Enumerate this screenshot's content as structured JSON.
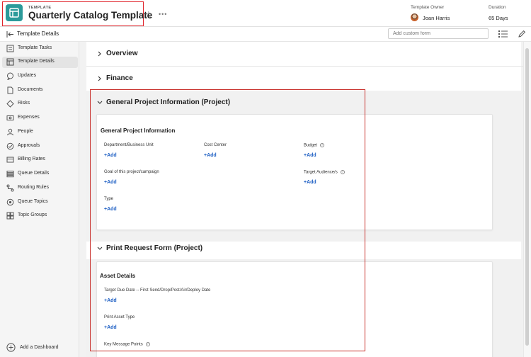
{
  "header": {
    "eyebrow": "TEMPLATE",
    "title": "Quarterly Catalog Template",
    "owner_label": "Template Owner",
    "owner_name": "Joan Harris",
    "duration_label": "Duration",
    "duration_value": "65 Days"
  },
  "subheader": {
    "title": "Template Details",
    "custom_form_placeholder": "Add custom form"
  },
  "sidebar": {
    "items": [
      {
        "label": "Template Tasks",
        "icon": "tasks-icon"
      },
      {
        "label": "Template Details",
        "icon": "details-icon",
        "active": true
      },
      {
        "label": "Updates",
        "icon": "chat-icon"
      },
      {
        "label": "Documents",
        "icon": "document-icon"
      },
      {
        "label": "Risks",
        "icon": "risk-icon"
      },
      {
        "label": "Expenses",
        "icon": "expenses-icon"
      },
      {
        "label": "People",
        "icon": "people-icon"
      },
      {
        "label": "Approvals",
        "icon": "approval-icon"
      },
      {
        "label": "Billing Rates",
        "icon": "billing-icon"
      },
      {
        "label": "Queue Details",
        "icon": "queue-icon"
      },
      {
        "label": "Routing Rules",
        "icon": "routing-icon"
      },
      {
        "label": "Queue Topics",
        "icon": "topics-icon"
      },
      {
        "label": "Topic Groups",
        "icon": "groups-icon"
      }
    ],
    "add_dashboard": "Add a Dashboard"
  },
  "sections": {
    "overview": "Overview",
    "finance": "Finance",
    "general": "General Project Information (Project)",
    "print": "Print Request Form (Project)"
  },
  "general_card": {
    "title": "General Project Information",
    "fields": {
      "department": "Department/Business Unit",
      "cost_center": "Cost Center",
      "budget": "Budget",
      "goal": "Goal of this project/campaign",
      "audience": "Target Audience/s",
      "type": "Type"
    }
  },
  "print_card": {
    "title": "Asset Details",
    "fields": {
      "due_date": "Target Due Date -- First Send/Drop/Post/Air/Deploy Date",
      "asset_type": "Print Asset Type",
      "key_points": "Key Message Points"
    }
  },
  "add_label": "+Add",
  "colors": {
    "brand_tile": "#2b9a9a",
    "link": "#1f60c4",
    "highlight": "#e0242b"
  }
}
